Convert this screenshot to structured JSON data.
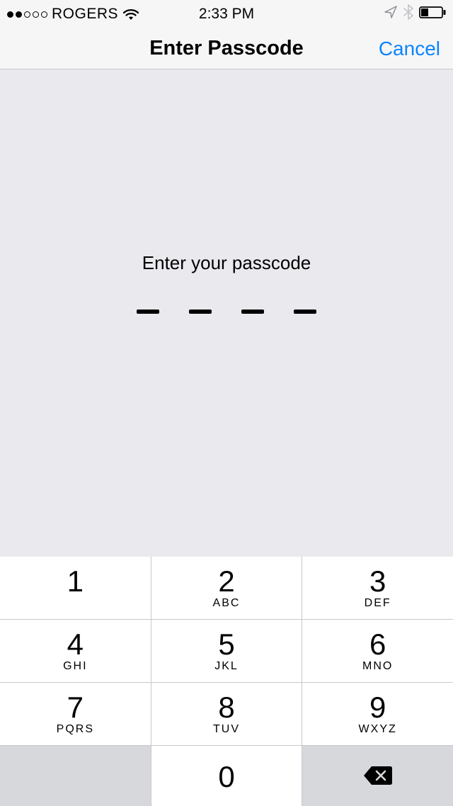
{
  "statusBar": {
    "carrier": "ROGERS",
    "time": "2:33 PM"
  },
  "navBar": {
    "title": "Enter Passcode",
    "cancel": "Cancel"
  },
  "passcode": {
    "prompt": "Enter your passcode",
    "length": 4
  },
  "keypad": {
    "keys": [
      {
        "digit": "1",
        "letters": ""
      },
      {
        "digit": "2",
        "letters": "ABC"
      },
      {
        "digit": "3",
        "letters": "DEF"
      },
      {
        "digit": "4",
        "letters": "GHI"
      },
      {
        "digit": "5",
        "letters": "JKL"
      },
      {
        "digit": "6",
        "letters": "MNO"
      },
      {
        "digit": "7",
        "letters": "PQRS"
      },
      {
        "digit": "8",
        "letters": "TUV"
      },
      {
        "digit": "9",
        "letters": "WXYZ"
      },
      {
        "digit": "0",
        "letters": ""
      }
    ]
  }
}
